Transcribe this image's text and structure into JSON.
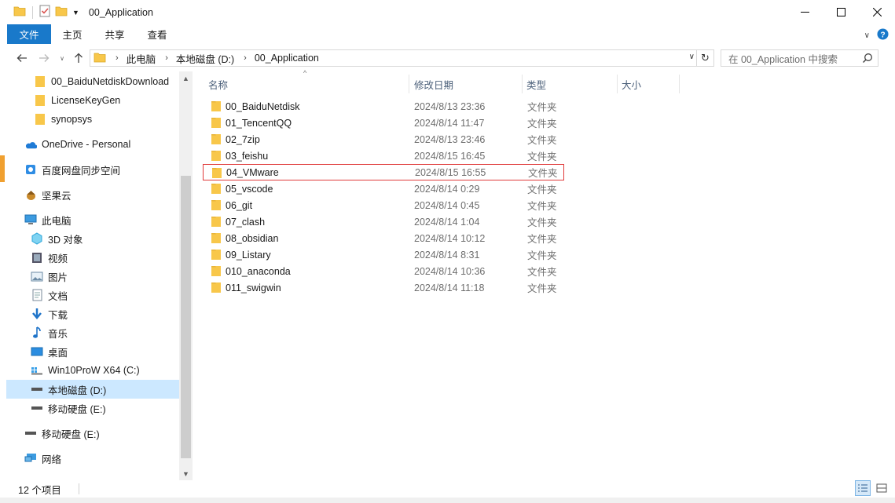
{
  "window": {
    "title": "00_Application",
    "controls": {
      "minimize_icon": "minimize-icon",
      "maximize_icon": "maximize-icon",
      "close_icon": "close-icon"
    }
  },
  "ribbon": {
    "tabs": [
      "文件",
      "主页",
      "共享",
      "查看"
    ]
  },
  "address": {
    "breadcrumbs": [
      "此电脑",
      "本地磁盘 (D:)",
      "00_Application"
    ]
  },
  "search": {
    "placeholder": "在 00_Application 中搜索"
  },
  "nav": {
    "items": [
      {
        "label": "00_BaiduNetdiskDownload",
        "icon": "folder-icon"
      },
      {
        "label": "LicenseKeyGen",
        "icon": "folder-icon"
      },
      {
        "label": "synopsys",
        "icon": "folder-icon"
      },
      {
        "label": "OneDrive - Personal",
        "icon": "onedrive-icon"
      },
      {
        "label": "百度网盘同步空间",
        "icon": "baidu-sync-icon"
      },
      {
        "label": "坚果云",
        "icon": "nutstore-icon"
      },
      {
        "label": "此电脑",
        "icon": "computer-icon"
      },
      {
        "label": "3D 对象",
        "icon": "3d-objects-icon"
      },
      {
        "label": "视频",
        "icon": "video-icon"
      },
      {
        "label": "图片",
        "icon": "pictures-icon"
      },
      {
        "label": "文档",
        "icon": "documents-icon"
      },
      {
        "label": "下载",
        "icon": "download-icon"
      },
      {
        "label": "音乐",
        "icon": "music-icon"
      },
      {
        "label": "桌面",
        "icon": "desktop-icon"
      },
      {
        "label": "Win10ProW X64 (C:)",
        "icon": "system-drive-icon"
      },
      {
        "label": "本地磁盘 (D:)",
        "icon": "drive-icon"
      },
      {
        "label": "移动硬盘 (E:)",
        "icon": "drive-icon"
      },
      {
        "label": "移动硬盘 (E:)",
        "icon": "drive-icon"
      },
      {
        "label": "网络",
        "icon": "network-icon"
      }
    ]
  },
  "columns": {
    "name": "名称",
    "date": "修改日期",
    "type": "类型",
    "size": "大小"
  },
  "files": [
    {
      "name": "00_BaiduNetdisk",
      "date": "2024/8/13 23:36",
      "type": "文件夹"
    },
    {
      "name": "01_TencentQQ",
      "date": "2024/8/14 11:47",
      "type": "文件夹"
    },
    {
      "name": "02_7zip",
      "date": "2024/8/13 23:46",
      "type": "文件夹"
    },
    {
      "name": "03_feishu",
      "date": "2024/8/15 16:45",
      "type": "文件夹"
    },
    {
      "name": "04_VMware",
      "date": "2024/8/15 16:55",
      "type": "文件夹"
    },
    {
      "name": "05_vscode",
      "date": "2024/8/14 0:29",
      "type": "文件夹"
    },
    {
      "name": "06_git",
      "date": "2024/8/14 0:45",
      "type": "文件夹"
    },
    {
      "name": "07_clash",
      "date": "2024/8/14 1:04",
      "type": "文件夹"
    },
    {
      "name": "08_obsidian",
      "date": "2024/8/14 10:12",
      "type": "文件夹"
    },
    {
      "name": "09_Listary",
      "date": "2024/8/14 8:31",
      "type": "文件夹"
    },
    {
      "name": "010_anaconda",
      "date": "2024/8/14 10:36",
      "type": "文件夹"
    },
    {
      "name": "011_swigwin",
      "date": "2024/8/14 11:18",
      "type": "文件夹"
    }
  ],
  "status": {
    "count": "12 个项目"
  },
  "colors": {
    "accent": "#1979ca",
    "folder": "#f8c74a",
    "selection": "#cce8ff",
    "highlight_border": "#e03a3a"
  }
}
